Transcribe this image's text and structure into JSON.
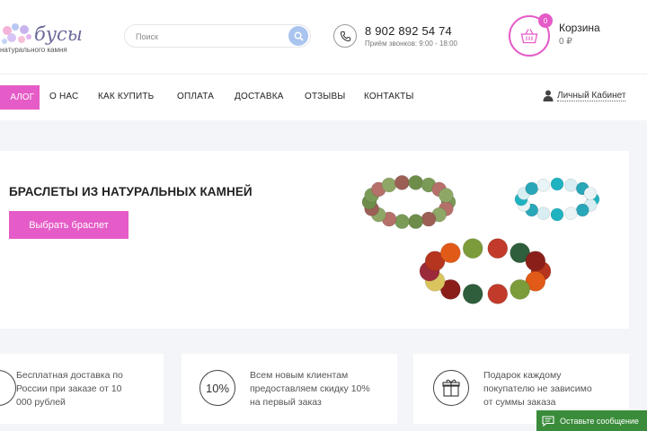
{
  "brand": {
    "name": "бусы",
    "tagline": "натурального камня"
  },
  "search": {
    "placeholder": "Поиск"
  },
  "contact": {
    "phone": "8 902 892 54 74",
    "hours": "Приём звонков: 9:00 - 18:00"
  },
  "cart": {
    "title": "Корзина",
    "count": "0",
    "sum": "0 ₽"
  },
  "nav": {
    "catalog": "АЛОГ",
    "items": [
      "О НАС",
      "КАК КУПИТЬ",
      "ОПЛАТА",
      "ДОСТАВКА",
      "ОТЗЫВЫ",
      "КОНТАКТЫ"
    ],
    "cabinet": "Личный Кабинет"
  },
  "banner": {
    "title": "БРАСЛЕТЫ ИЗ НАТУРАЛЬНЫХ КАМНЕЙ",
    "button": "Выбрать браслет"
  },
  "features": [
    {
      "text": [
        "Бесплатная доставка по",
        "России при заказе от 10",
        "000 рублей"
      ],
      "icon": "delivery-icon"
    },
    {
      "text": [
        "Всем новым клиентам",
        "предоставляем скидку 10%",
        "на первый заказ"
      ],
      "icon": "10%"
    },
    {
      "text": [
        "Подарок каждому",
        "покупателю не зависимо",
        "от суммы заказа"
      ],
      "icon": "gift-icon"
    }
  ],
  "chat": {
    "label": "Оставьте сообщение"
  },
  "colors": {
    "accent": "#e55bc7",
    "chat": "#3a8c3a",
    "search_button": "#a9c4ef"
  }
}
